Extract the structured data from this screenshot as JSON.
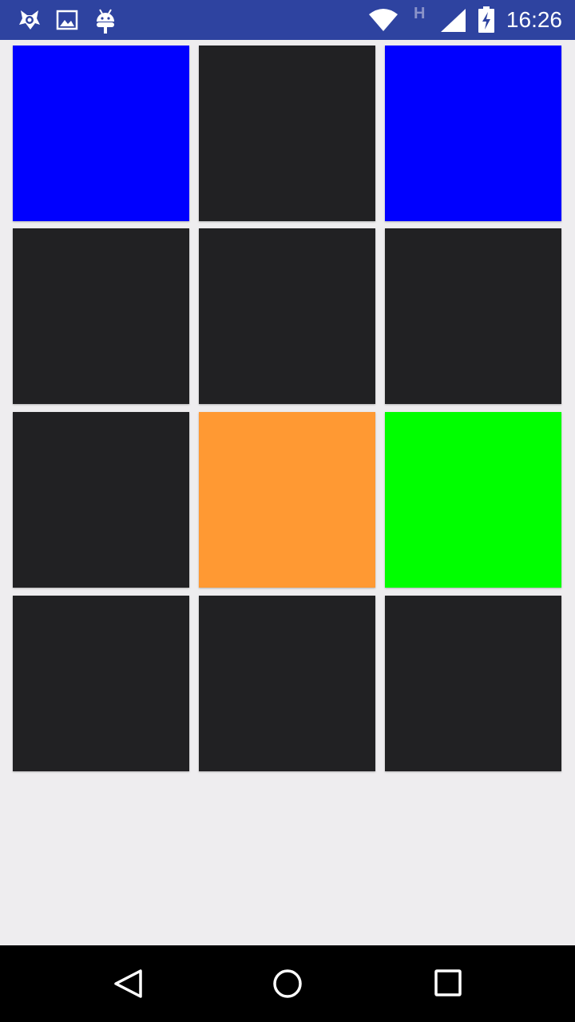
{
  "status_bar": {
    "time": "16:26",
    "network_label": "H",
    "background": "#2e43a0",
    "icons": [
      "app-notification-icon",
      "image-notification-icon",
      "android-debug-icon",
      "wifi-icon",
      "network-type-icon",
      "cell-signal-icon",
      "battery-charging-icon"
    ]
  },
  "grid": {
    "rows": 4,
    "columns": 3,
    "tiles": [
      {
        "color": "#0000ff"
      },
      {
        "color": "#212123"
      },
      {
        "color": "#0000ff"
      },
      {
        "color": "#212123"
      },
      {
        "color": "#212123"
      },
      {
        "color": "#212123"
      },
      {
        "color": "#212123"
      },
      {
        "color": "#ff9933"
      },
      {
        "color": "#00ff00"
      },
      {
        "color": "#212123"
      },
      {
        "color": "#212123"
      },
      {
        "color": "#212123"
      }
    ]
  },
  "nav_bar": {
    "buttons": [
      "back-icon",
      "home-icon",
      "recents-icon"
    ]
  }
}
